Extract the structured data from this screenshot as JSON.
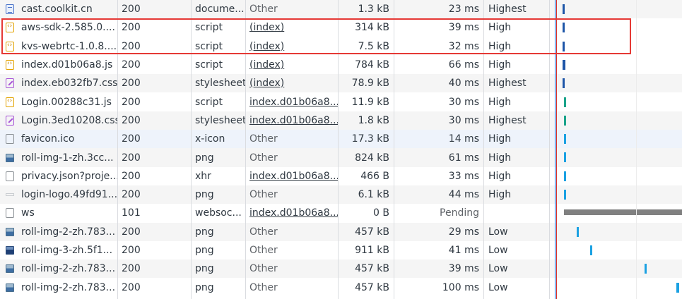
{
  "requests": [
    {
      "name": "cast.coolkit.cn",
      "status": "200",
      "type": "docume...",
      "initiator": "Other",
      "initiator_link": false,
      "size": "1.3 kB",
      "time": "23 ms",
      "priority": "Highest",
      "icon": "document-icon",
      "kind": "doc",
      "bar": {
        "s": 0.1,
        "w": 0.015,
        "c": "#1e56a8"
      }
    },
    {
      "name": "aws-sdk-2.585.0....",
      "status": "200",
      "type": "script",
      "initiator": "(index)",
      "initiator_link": true,
      "size": "314 kB",
      "time": "39 ms",
      "priority": "High",
      "icon": "script-icon",
      "kind": "script",
      "bar": {
        "s": 0.1,
        "w": 0.015,
        "c": "#1e56a8"
      }
    },
    {
      "name": "kvs-webrtc-1.0.8....",
      "status": "200",
      "type": "script",
      "initiator": "(index)",
      "initiator_link": true,
      "size": "7.5 kB",
      "time": "32 ms",
      "priority": "High",
      "icon": "script-icon",
      "kind": "script",
      "bar": {
        "s": 0.1,
        "w": 0.015,
        "c": "#1e56a8"
      }
    },
    {
      "name": "index.d01b06a8.js",
      "status": "200",
      "type": "script",
      "initiator": "(index)",
      "initiator_link": true,
      "size": "784 kB",
      "time": "66 ms",
      "priority": "High",
      "icon": "script-icon",
      "kind": "script",
      "bar": {
        "s": 0.1,
        "w": 0.02,
        "c": "#1e56a8"
      }
    },
    {
      "name": "index.eb032fb7.css",
      "status": "200",
      "type": "stylesheet",
      "initiator": "(index)",
      "initiator_link": true,
      "size": "78.9 kB",
      "time": "40 ms",
      "priority": "Highest",
      "icon": "stylesheet-icon",
      "kind": "css",
      "bar": {
        "s": 0.1,
        "w": 0.015,
        "c": "#1e56a8"
      }
    },
    {
      "name": "Login.00288c31.js",
      "status": "200",
      "type": "script",
      "initiator": "index.d01b06a8....",
      "initiator_link": true,
      "size": "11.9 kB",
      "time": "30 ms",
      "priority": "High",
      "icon": "script-icon",
      "kind": "script",
      "bar": {
        "s": 0.11,
        "w": 0.015,
        "c": "#1aa38a"
      }
    },
    {
      "name": "Login.3ed10208.css",
      "status": "200",
      "type": "stylesheet",
      "initiator": "index.d01b06a8....",
      "initiator_link": true,
      "size": "1.8 kB",
      "time": "30 ms",
      "priority": "Highest",
      "icon": "stylesheet-icon",
      "kind": "css",
      "bar": {
        "s": 0.11,
        "w": 0.015,
        "c": "#1aa38a"
      }
    },
    {
      "name": "favicon.ico",
      "status": "200",
      "type": "x-icon",
      "initiator": "Other",
      "initiator_link": false,
      "size": "17.3 kB",
      "time": "14 ms",
      "priority": "High",
      "icon": "file-icon",
      "kind": "generic",
      "bar": {
        "s": 0.11,
        "w": 0.012,
        "c": "#1ba1e2"
      }
    },
    {
      "name": "roll-img-1-zh.3cc...",
      "status": "200",
      "type": "png",
      "initiator": "Other",
      "initiator_link": false,
      "size": "824 kB",
      "time": "61 ms",
      "priority": "High",
      "icon": "image-icon",
      "kind": "img",
      "bar": {
        "s": 0.11,
        "w": 0.012,
        "c": "#1ba1e2"
      }
    },
    {
      "name": "privacy.json?proje...",
      "status": "200",
      "type": "xhr",
      "initiator": "index.d01b06a8....",
      "initiator_link": true,
      "size": "466 B",
      "time": "33 ms",
      "priority": "High",
      "icon": "file-icon",
      "kind": "generic",
      "bar": {
        "s": 0.11,
        "w": 0.012,
        "c": "#1ba1e2"
      }
    },
    {
      "name": "login-logo.49fd91...",
      "status": "200",
      "type": "png",
      "initiator": "Other",
      "initiator_link": false,
      "size": "6.1 kB",
      "time": "44 ms",
      "priority": "High",
      "icon": "logo-image-icon",
      "kind": "logo",
      "bar": {
        "s": 0.11,
        "w": 0.012,
        "c": "#1ba1e2"
      }
    },
    {
      "name": "ws",
      "status": "101",
      "type": "websoc...",
      "initiator": "index.d01b06a8....",
      "initiator_link": true,
      "size": "0 B",
      "time": "Pending",
      "time_muted": true,
      "priority": "",
      "icon": "file-icon",
      "kind": "generic",
      "bar": {
        "s": 0.11,
        "w": 0.89,
        "c": "#808080",
        "thick": true
      }
    },
    {
      "name": "roll-img-2-zh.783...",
      "status": "200",
      "type": "png",
      "initiator": "Other",
      "initiator_link": false,
      "size": "457 kB",
      "time": "29 ms",
      "priority": "Low",
      "icon": "image-icon",
      "kind": "img",
      "bar": {
        "s": 0.21,
        "w": 0.012,
        "c": "#1ba1e2"
      }
    },
    {
      "name": "roll-img-3-zh.5f1...",
      "status": "200",
      "type": "png",
      "initiator": "Other",
      "initiator_link": false,
      "size": "911 kB",
      "time": "41 ms",
      "priority": "Low",
      "icon": "image-icon",
      "kind": "imgdark",
      "bar": {
        "s": 0.31,
        "w": 0.012,
        "c": "#1ba1e2"
      }
    },
    {
      "name": "roll-img-2-zh.783...",
      "status": "200",
      "type": "png",
      "initiator": "Other",
      "initiator_link": false,
      "size": "457 kB",
      "time": "39 ms",
      "priority": "Low",
      "icon": "image-icon",
      "kind": "img",
      "bar": {
        "s": 0.72,
        "w": 0.012,
        "c": "#1ba1e2"
      }
    },
    {
      "name": "roll-img-2-zh.783...",
      "status": "200",
      "type": "png",
      "initiator": "Other",
      "initiator_link": false,
      "size": "457 kB",
      "time": "100 ms",
      "priority": "Low",
      "icon": "image-icon",
      "kind": "img",
      "bar": {
        "s": 0.96,
        "w": 0.02,
        "c": "#1ba1e2"
      }
    }
  ],
  "highlighted_rows": [
    1,
    2
  ],
  "highlight_color": "#e53935"
}
